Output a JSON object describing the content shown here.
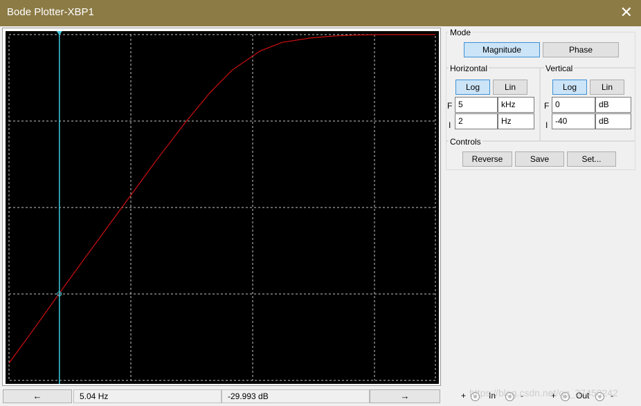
{
  "window": {
    "title": "Bode Plotter-XBP1",
    "close_icon": "close-icon"
  },
  "mode": {
    "label": "Mode",
    "buttons": [
      {
        "label": "Magnitude",
        "active": true
      },
      {
        "label": "Phase",
        "active": false
      }
    ]
  },
  "horizontal": {
    "label": "Horizontal",
    "log_label": "Log",
    "lin_label": "Lin",
    "scale": "Log",
    "final": {
      "prefix": "F",
      "value": "5",
      "unit": "kHz"
    },
    "initial": {
      "prefix": "I",
      "value": "2",
      "unit": "Hz"
    }
  },
  "vertical": {
    "label": "Vertical",
    "log_label": "Log",
    "lin_label": "Lin",
    "scale": "Log",
    "final": {
      "prefix": "F",
      "value": "0",
      "unit": "dB"
    },
    "initial": {
      "prefix": "I",
      "value": "-40",
      "unit": "dB"
    }
  },
  "controls": {
    "label": "Controls",
    "reverse_label": "Reverse",
    "save_label": "Save",
    "set_label": "Set..."
  },
  "readout": {
    "left_arrow": "←",
    "right_arrow": "→",
    "frequency": "5.04  Hz",
    "magnitude": "-29.993 dB"
  },
  "terminals": {
    "in_plus": "+",
    "in_label": "In",
    "in_minus": "-",
    "out_plus": "+",
    "out_label": "Out",
    "out_minus": "-"
  },
  "watermark": "https://blog.csdn.net/qq_37450242",
  "colors": {
    "titlebar": "#8c7b45",
    "plot_background": "#000000",
    "curve": "#d01010",
    "cursor": "#40c8d8",
    "grid": "#c8c8c8",
    "active_button": "#cce4f7"
  },
  "chart_data": {
    "type": "line",
    "title": "",
    "xlabel": "",
    "ylabel": "",
    "xscale": "log",
    "xlim": [
      2,
      5000
    ],
    "ylim": [
      -40,
      0
    ],
    "grid": true,
    "series": [
      {
        "x": [
          2,
          3,
          5,
          8,
          12,
          20,
          30,
          50,
          80,
          120,
          200,
          300,
          500,
          800,
          1200,
          2000,
          3000,
          5000
        ],
        "y": [
          -38,
          -34.5,
          -30,
          -25.9,
          -22.4,
          -18,
          -14.5,
          -10.3,
          -6.7,
          -4.1,
          -1.9,
          -0.9,
          -0.4,
          -0.15,
          -0.05,
          0,
          0,
          0
        ]
      }
    ],
    "cursor": {
      "x": 5.04,
      "y": -29.993
    }
  }
}
